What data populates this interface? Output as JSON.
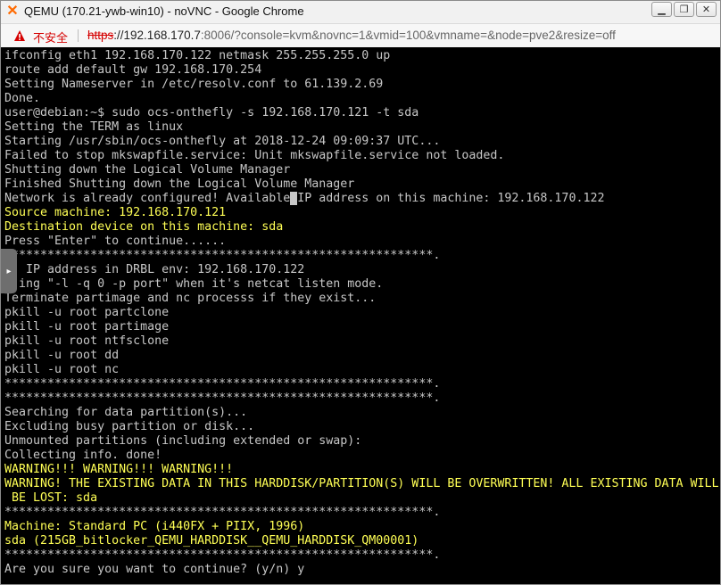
{
  "window": {
    "title": "QEMU (170.21-ywb-win10) - noVNC - Google Chrome",
    "app_icon": "proxmox-x-icon",
    "controls": [
      "minimize-icon",
      "restore-icon",
      "close-icon"
    ]
  },
  "address": {
    "security_label": "不安全",
    "url_scheme": "https",
    "url_host": "://192.168.170.7",
    "url_rest": ":8006/?console=kvm&novnc=1&vmid=100&vmname=&node=pve2&resize=off"
  },
  "terminal": {
    "lines": [
      {
        "text": "ifconfig eth1 192.168.170.122 netmask 255.255.255.0 up",
        "color": "#c7c7c7"
      },
      {
        "text": "route add default gw 192.168.170.254",
        "color": "#c7c7c7"
      },
      {
        "text": "Setting Nameserver in /etc/resolv.conf to 61.139.2.69",
        "color": "#c7c7c7"
      },
      {
        "text": "Done.",
        "color": "#c7c7c7"
      },
      {
        "text": "user@debian:~$ sudo ocs-onthefly -s 192.168.170.121 -t sda",
        "color": "#c7c7c7"
      },
      {
        "text": "Setting the TERM as linux",
        "color": "#c7c7c7"
      },
      {
        "text": "Starting /usr/sbin/ocs-onthefly at 2018-12-24 09:09:37 UTC...",
        "color": "#c7c7c7"
      },
      {
        "text": "Failed to stop mkswapfile.service: Unit mkswapfile.service not loaded.",
        "color": "#c7c7c7"
      },
      {
        "text": "Shutting down the Logical Volume Manager",
        "color": "#c7c7c7"
      },
      {
        "text": "Finished Shutting down the Logical Volume Manager",
        "color": "#c7c7c7"
      },
      {
        "text": "Network is already configured! Available",
        "cursor": " ",
        "after": "IP address on this machine: 192.168.170.122",
        "color": "#c7c7c7"
      },
      {
        "text": "Source machine: 192.168.170.121",
        "color": "#ffff55"
      },
      {
        "text": "Destination device on this machine: sda",
        "color": "#ffff55"
      },
      {
        "text": "Press \"Enter\" to continue......",
        "color": "#c7c7c7"
      },
      {
        "text": "************************************************************.",
        "color": "#c7c7c7"
      },
      {
        "text": "   IP address in DRBL env: 192.168.170.122",
        "color": "#c7c7c7"
      },
      {
        "text": "  ing \"-l -q 0 -p port\" when it's netcat listen mode.",
        "color": "#c7c7c7"
      },
      {
        "text": "Terminate partimage and nc processs if they exist...",
        "color": "#c7c7c7"
      },
      {
        "text": "pkill -u root partclone",
        "color": "#c7c7c7"
      },
      {
        "text": "pkill -u root partimage",
        "color": "#c7c7c7"
      },
      {
        "text": "pkill -u root ntfsclone",
        "color": "#c7c7c7"
      },
      {
        "text": "pkill -u root dd",
        "color": "#c7c7c7"
      },
      {
        "text": "pkill -u root nc",
        "color": "#c7c7c7"
      },
      {
        "text": "************************************************************.",
        "color": "#c7c7c7"
      },
      {
        "text": "************************************************************.",
        "color": "#c7c7c7"
      },
      {
        "text": "Searching for data partition(s)...",
        "color": "#c7c7c7"
      },
      {
        "text": "Excluding busy partition or disk...",
        "color": "#c7c7c7"
      },
      {
        "text": "Unmounted partitions (including extended or swap):",
        "color": "#c7c7c7"
      },
      {
        "text": "Collecting info. done!",
        "color": "#c7c7c7"
      },
      {
        "text": "WARNING!!! WARNING!!! WARNING!!!",
        "color": "#ffff55"
      },
      {
        "text": "WARNING! THE EXISTING DATA IN THIS HARDDISK/PARTITION(S) WILL BE OVERWRITTEN! ALL EXISTING DATA WILL",
        "color": "#ffff55"
      },
      {
        "text": " BE LOST: sda",
        "color": "#ffff55"
      },
      {
        "text": "************************************************************.",
        "color": "#c7c7c7"
      },
      {
        "text": "Machine: Standard PC (i440FX + PIIX, 1996)",
        "color": "#ffff55"
      },
      {
        "text": "sda (215GB_bitlocker_QEMU_HARDDISK__QEMU_HARDDISK_QM00001)",
        "color": "#ffff55"
      },
      {
        "text": "************************************************************.",
        "color": "#c7c7c7"
      },
      {
        "text": "Are you sure you want to continue? (y/n) y",
        "color": "#c7c7c7"
      }
    ]
  },
  "novnc": {
    "sidebar_handle_icon": "chevron-right-icon",
    "sidebar_handle_glyph": "▸"
  }
}
